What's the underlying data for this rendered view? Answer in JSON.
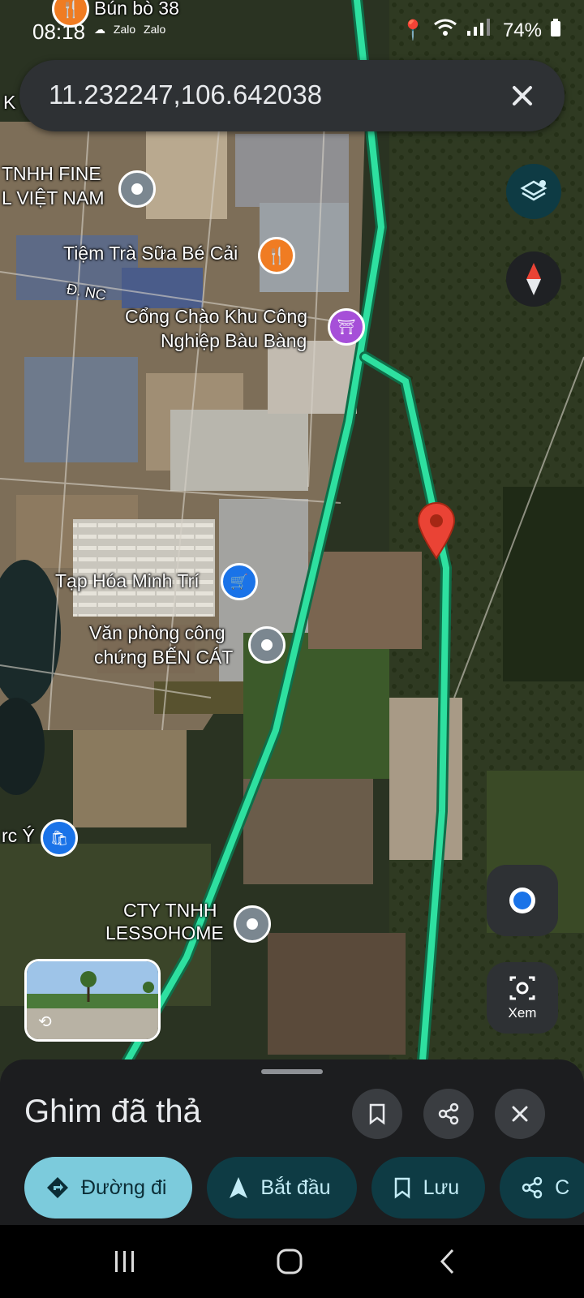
{
  "status_bar": {
    "time": "08:18",
    "notif_icons": [
      "cloud-icon",
      "Zalo",
      "Zalo"
    ],
    "battery": "74%"
  },
  "search": {
    "query": "11.232247,106.642038"
  },
  "map_labels": {
    "restaurant_top": "Bún bò 38",
    "company_fine_line1": "TNHH FINE",
    "company_fine_line2": "L VIỆT NAM",
    "tea_shop": "Tiệm Trà Sữa Bé Cải",
    "road_nc": "Đ. NC",
    "gate_line1": "Cổng Chào Khu Công",
    "gate_line2": "Nghiệp Bàu Bàng",
    "grocery": "Tạp Hóa Minh Trí",
    "notary_line1": "Văn phòng công",
    "notary_line2": "chứng BẾN CÁT",
    "shop_left": "rc Ý",
    "lesso_line1": "CTY TNHH",
    "lesso_line2": "LESSOHOME",
    "edge_k": "K"
  },
  "controls": {
    "xem_label": "Xem"
  },
  "sheet": {
    "title": "Ghim đã thả",
    "chips": [
      {
        "label": "Đường đi",
        "icon": "directions-icon"
      },
      {
        "label": "Bắt đầu",
        "icon": "navigation-arrow-icon"
      },
      {
        "label": "Lưu",
        "icon": "bookmark-icon"
      },
      {
        "label": "C",
        "icon": "share-icon"
      }
    ]
  },
  "colors": {
    "route": "#2ee0a0",
    "pin": "#ea4335",
    "primary_chip": "#7ccbdc",
    "tonal_chip": "#0e3b44"
  }
}
